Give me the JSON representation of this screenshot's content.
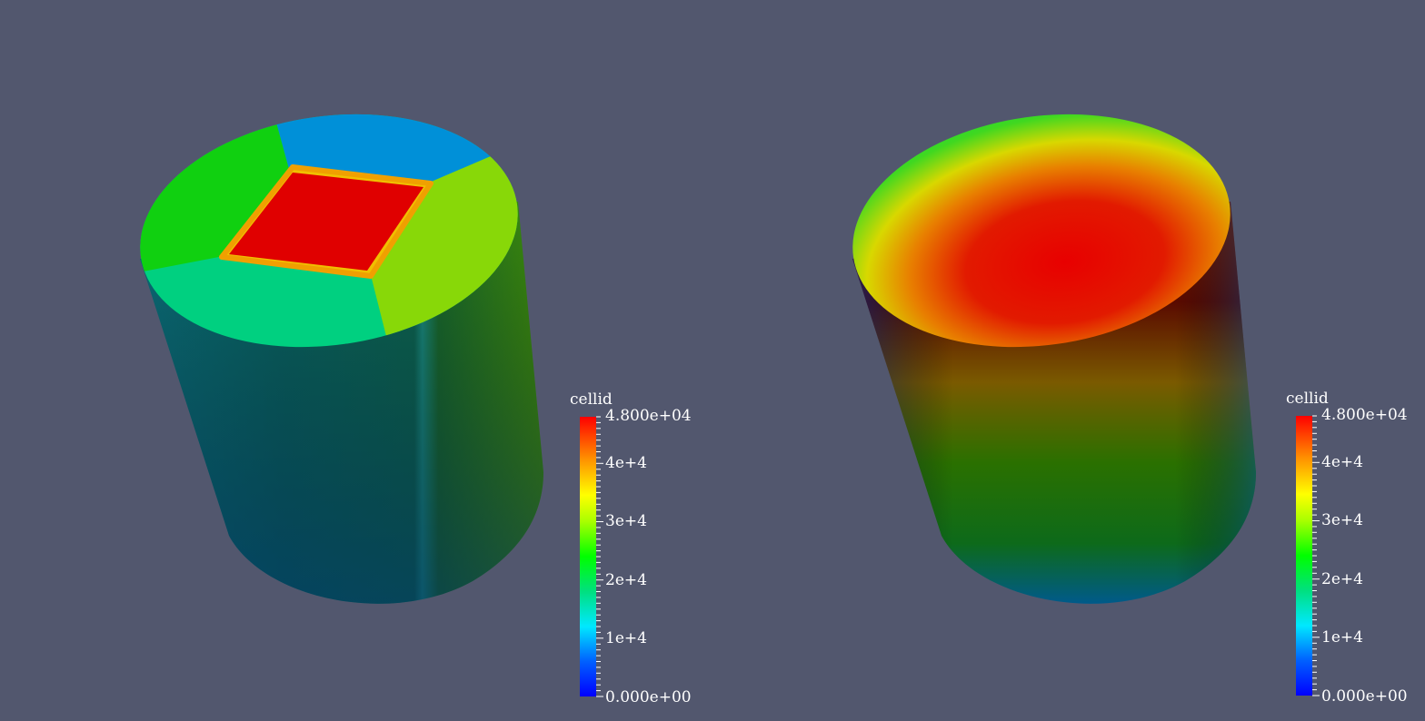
{
  "panels": [
    {
      "name": "left-view",
      "scalar_bar": {
        "title": "cellid",
        "max_label": "4.800e+04",
        "min_label": "0.000e+00",
        "tick_labels": [
          "4e+4",
          "3e+4",
          "2e+4",
          "1e+4"
        ]
      }
    },
    {
      "name": "right-view",
      "scalar_bar": {
        "title": "cellid",
        "max_label": "4.800e+04",
        "min_label": "0.000e+00",
        "tick_labels": [
          "4e+4",
          "3e+4",
          "2e+4",
          "1e+4"
        ]
      }
    }
  ],
  "colors": {
    "background": "#52576e",
    "colormap": [
      "#0000ff",
      "#00a0ff",
      "#00ffff",
      "#00e080",
      "#00ff00",
      "#b0ff00",
      "#ffff00",
      "#ff9000",
      "#ff0000"
    ]
  }
}
